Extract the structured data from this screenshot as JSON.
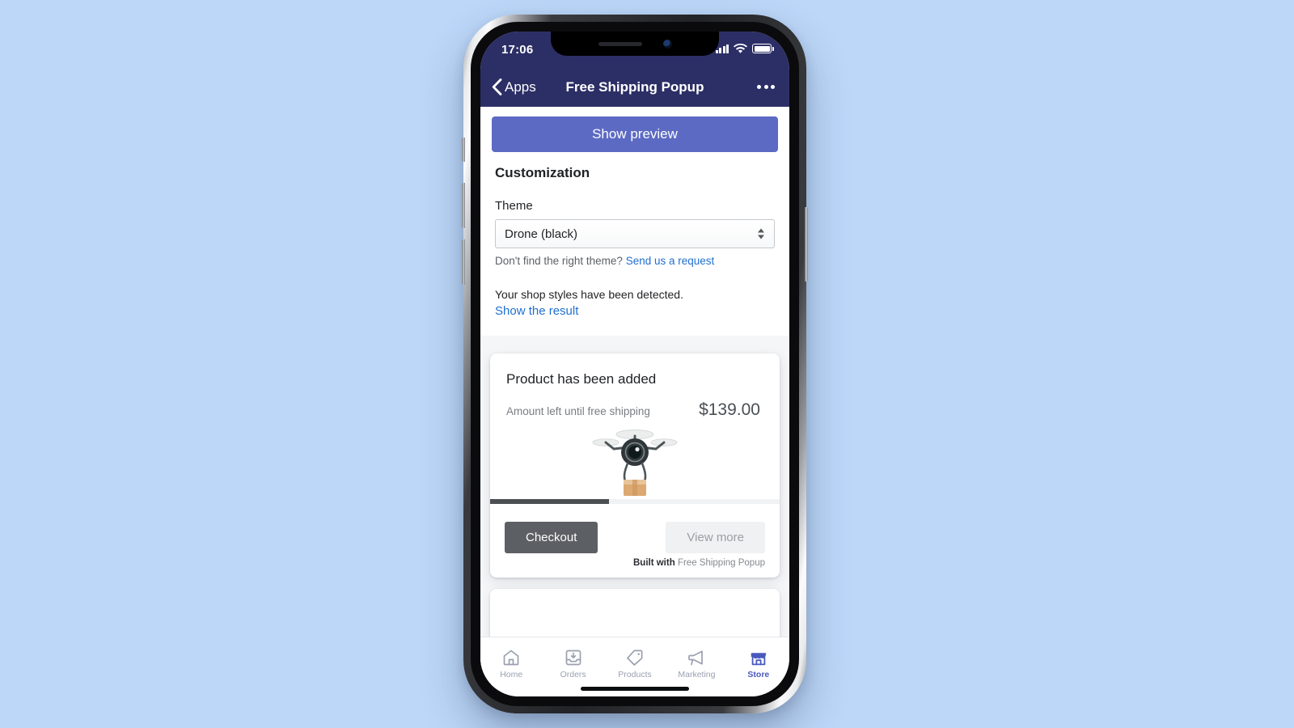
{
  "status_bar": {
    "time": "17:06",
    "signal_icon": "cellular-signal-icon",
    "wifi_icon": "wifi-icon",
    "battery_icon": "battery-icon"
  },
  "nav_bar": {
    "back_label": "Apps",
    "back_icon": "chevron-left-icon",
    "title": "Free Shipping Popup",
    "more_icon": "more-horizontal-icon"
  },
  "actions": {
    "show_preview_label": "Show preview"
  },
  "customization": {
    "heading": "Customization",
    "theme_label": "Theme",
    "theme_value": "Drone (black)",
    "theme_stepper_icon": "stepper-updown-icon",
    "hint_text": "Don't find the right theme?",
    "hint_link": "Send us a request",
    "detected_text": "Your shop styles have been detected.",
    "detected_link": "Show the result"
  },
  "popup_preview": {
    "title": "Product has been added",
    "subtitle": "Amount left until free shipping",
    "amount": "$139.00",
    "illustration_icon": "drone-delivery-icon",
    "progress_percent": 41,
    "checkout_label": "Checkout",
    "view_more_label": "View more",
    "built_with_prefix": "Built with",
    "built_with_name": "Free Shipping Popup"
  },
  "tab_bar": {
    "items": [
      {
        "label": "Home",
        "icon": "home-icon",
        "active": false
      },
      {
        "label": "Orders",
        "icon": "orders-icon",
        "active": false
      },
      {
        "label": "Products",
        "icon": "products-tag-icon",
        "active": false
      },
      {
        "label": "Marketing",
        "icon": "megaphone-icon",
        "active": false
      },
      {
        "label": "Store",
        "icon": "storefront-icon",
        "active": true
      }
    ]
  },
  "colors": {
    "page_background": "#bcd7f8",
    "nav_bar": "#2c2f66",
    "accent": "#5c6ac4",
    "link": "#1f6fd0",
    "active_tab": "#4959bd",
    "progress_fill": "#4c4f52"
  }
}
